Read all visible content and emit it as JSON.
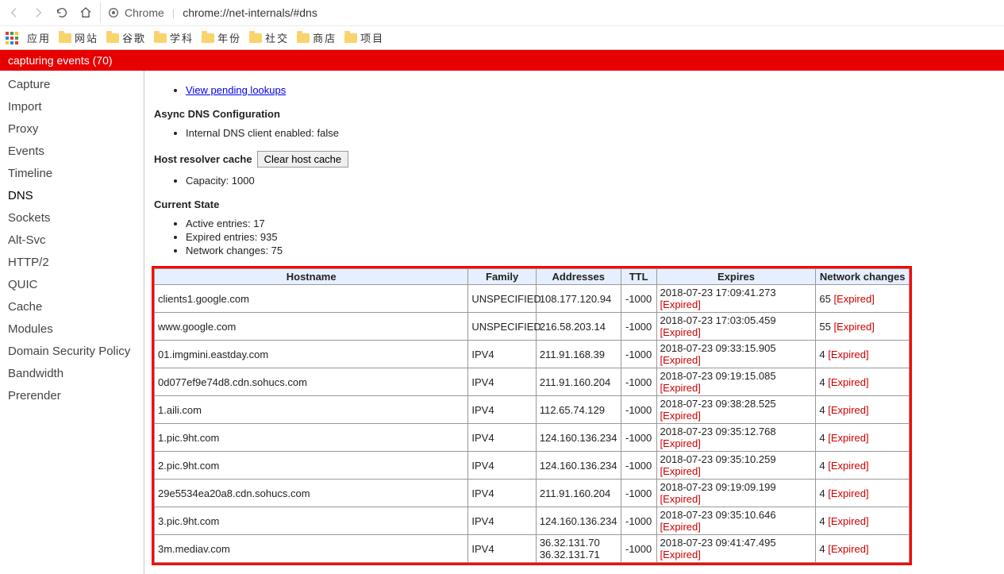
{
  "chrome": {
    "label": "Chrome",
    "url": "chrome://net-internals/#dns"
  },
  "bookmarks": {
    "apps": "应用",
    "items": [
      "网站",
      "谷歌",
      "学科",
      "年份",
      "社交",
      "商店",
      "项目"
    ]
  },
  "banner": "capturing events (70)",
  "sidebar": {
    "items": [
      "Capture",
      "Import",
      "Proxy",
      "Events",
      "Timeline",
      "DNS",
      "Sockets",
      "Alt-Svc",
      "HTTP/2",
      "QUIC",
      "Cache",
      "Modules",
      "Domain Security Policy",
      "Bandwidth",
      "Prerender"
    ],
    "active_index": 5
  },
  "content": {
    "pending_link": "View pending lookups",
    "async_heading": "Async DNS Configuration",
    "internal_dns": "Internal DNS client enabled: false",
    "resolver_heading": "Host resolver cache",
    "clear_button": "Clear host cache",
    "capacity": "Capacity: 1000",
    "current_state_heading": "Current State",
    "active_entries": "Active entries: 17",
    "expired_entries": "Expired entries: 935",
    "network_changes": "Network changes: 75",
    "expired_tag": "[Expired]"
  },
  "table": {
    "headers": [
      "Hostname",
      "Family",
      "Addresses",
      "TTL",
      "Expires",
      "Network changes"
    ],
    "rows": [
      {
        "host": "clients1.google.com",
        "fam": "UNSPECIFIED",
        "addr": "108.177.120.94",
        "ttl": "-1000",
        "exp": "2018-07-23 17:09:41.273",
        "net": "65"
      },
      {
        "host": "www.google.com",
        "fam": "UNSPECIFIED",
        "addr": "216.58.203.14",
        "ttl": "-1000",
        "exp": "2018-07-23 17:03:05.459",
        "net": "55"
      },
      {
        "host": "01.imgmini.eastday.com",
        "fam": "IPV4",
        "addr": "211.91.168.39",
        "ttl": "-1000",
        "exp": "2018-07-23 09:33:15.905",
        "net": "4"
      },
      {
        "host": "0d077ef9e74d8.cdn.sohucs.com",
        "fam": "IPV4",
        "addr": "211.91.160.204",
        "ttl": "-1000",
        "exp": "2018-07-23 09:19:15.085",
        "net": "4"
      },
      {
        "host": "1.aili.com",
        "fam": "IPV4",
        "addr": "112.65.74.129",
        "ttl": "-1000",
        "exp": "2018-07-23 09:38:28.525",
        "net": "4"
      },
      {
        "host": "1.pic.9ht.com",
        "fam": "IPV4",
        "addr": "124.160.136.234",
        "ttl": "-1000",
        "exp": "2018-07-23 09:35:12.768",
        "net": "4"
      },
      {
        "host": "2.pic.9ht.com",
        "fam": "IPV4",
        "addr": "124.160.136.234",
        "ttl": "-1000",
        "exp": "2018-07-23 09:35:10.259",
        "net": "4"
      },
      {
        "host": "29e5534ea20a8.cdn.sohucs.com",
        "fam": "IPV4",
        "addr": "211.91.160.204",
        "ttl": "-1000",
        "exp": "2018-07-23 09:19:09.199",
        "net": "4"
      },
      {
        "host": "3.pic.9ht.com",
        "fam": "IPV4",
        "addr": "124.160.136.234",
        "ttl": "-1000",
        "exp": "2018-07-23 09:35:10.646",
        "net": "4"
      },
      {
        "host": "3m.mediav.com",
        "fam": "IPV4",
        "addr": "36.32.131.70\n36.32.131.71",
        "ttl": "-1000",
        "exp": "2018-07-23 09:41:47.495",
        "net": "4"
      }
    ]
  }
}
